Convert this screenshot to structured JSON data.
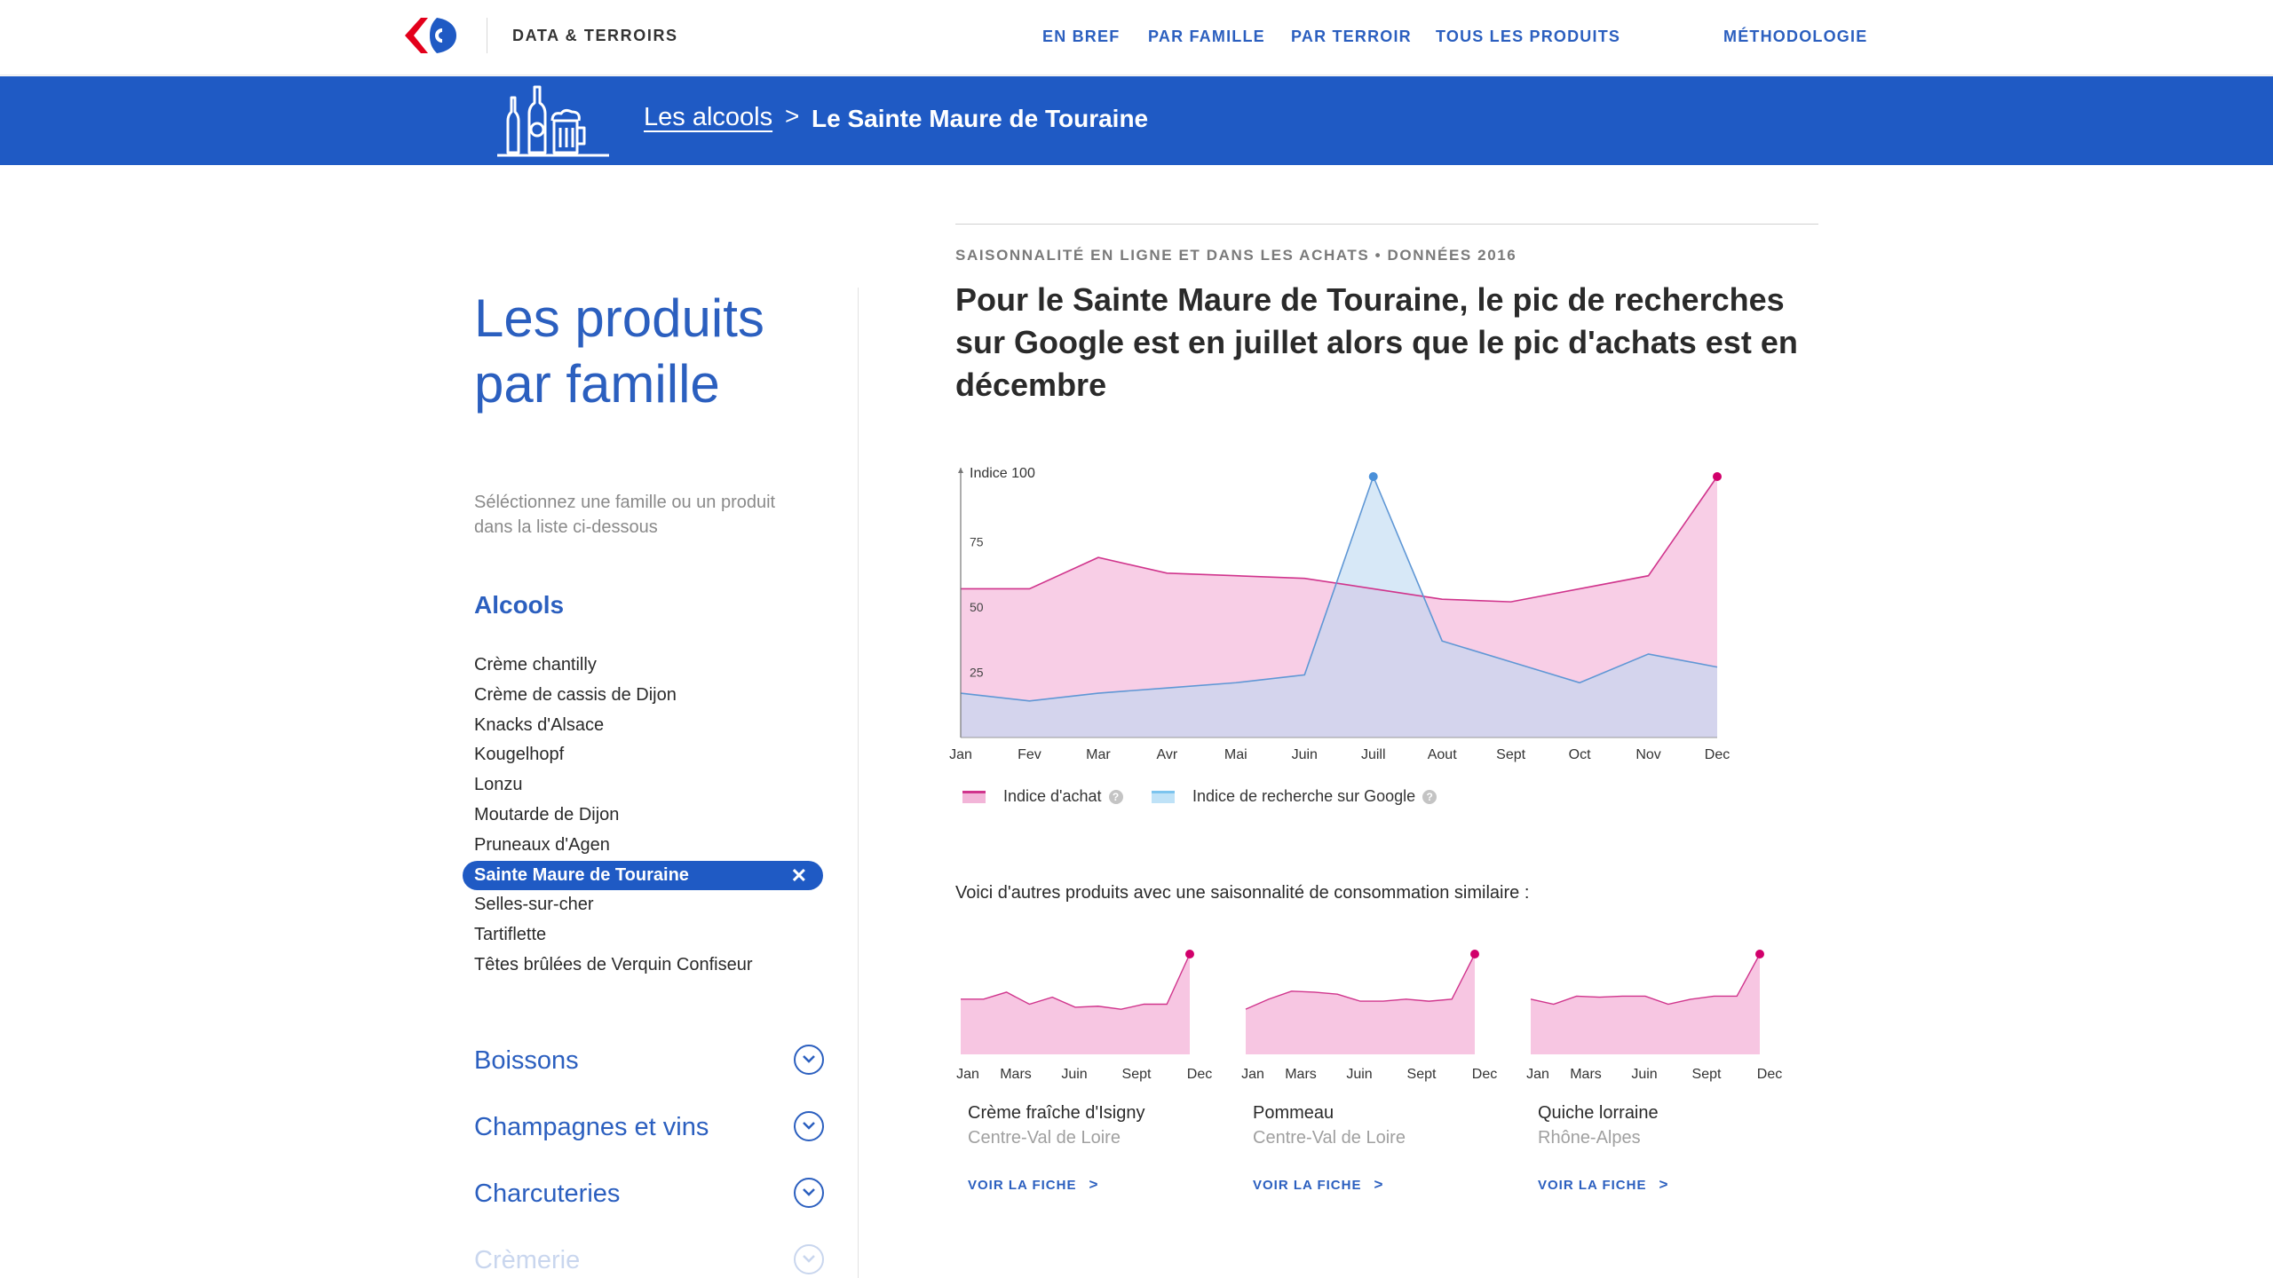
{
  "header": {
    "brand": "DATA & TERROIRS",
    "nav": [
      "EN BREF",
      "PAR FAMILLE",
      "PAR TERROIR",
      "TOUS LES PRODUITS",
      "MÉTHODOLOGIE"
    ]
  },
  "breadcrumb": {
    "parent": "Les alcools",
    "separator": ">",
    "current": "Le Sainte Maure de Touraine"
  },
  "sidebar": {
    "title_line1": "Les produits",
    "title_line2": "par famille",
    "hint": "Séléctionnez une famille ou un produit dans la liste ci-dessous",
    "family": "Alcools",
    "items": [
      "Crème chantilly",
      "Crème de cassis de Dijon",
      "Knacks d'Alsace",
      "Kougelhopf",
      "Lonzu",
      "Moutarde de Dijon",
      "Pruneaux d'Agen",
      "Sainte Maure de Touraine",
      "Selles-sur-cher",
      "Tartiflette",
      "Têtes brûlées de Verquin Confiseur"
    ],
    "selected_index": 7,
    "remove_glyph": "✕",
    "categories": [
      "Boissons",
      "Champagnes et vins",
      "Charcuteries",
      "Crèmerie"
    ]
  },
  "main": {
    "kicker": "SAISONNALITÉ EN LIGNE ET DANS LES ACHATS • DONNÉES 2016",
    "headline": "Pour le Sainte Maure de Touraine, le pic de recherches sur Google est en juillet alors que le pic d'achats est en décembre",
    "legend_purchase": "Indice d'achat",
    "legend_google": "Indice de recherche sur Google",
    "help_glyph": "?",
    "similar_intro": "Voici d'autres produits avec une saisonnalité de consommation similaire :",
    "similar_products": [
      {
        "name": "Crème fraîche d'Isigny",
        "region": "Centre-Val de Loire",
        "link": "VOIR LA FICHE",
        "arrow": ">"
      },
      {
        "name": "Pommeau",
        "region": "Centre-Val de Loire",
        "link": "VOIR LA FICHE",
        "arrow": ">"
      },
      {
        "name": "Quiche lorraine",
        "region": "Rhône-Alpes",
        "link": "VOIR LA FICHE",
        "arrow": ">"
      }
    ]
  },
  "colors": {
    "brand_blue": "#1f5ac4",
    "purchase_fill": "#f7c6e2",
    "purchase_line": "#d0348c",
    "purchase_peak": "#d1006b",
    "google_fill": "#bcd9f1",
    "google_line": "#5f97d5",
    "google_peak": "#4a90d9"
  },
  "chart_data": {
    "type": "area",
    "y_axis_label": "Indice 100",
    "y_ticks": [
      25,
      50,
      75
    ],
    "ylim": [
      0,
      100
    ],
    "categories": [
      "Jan",
      "Fev",
      "Mar",
      "Avr",
      "Mai",
      "Juin",
      "Juill",
      "Aout",
      "Sept",
      "Oct",
      "Nov",
      "Dec"
    ],
    "series": [
      {
        "name": "Indice d'achat",
        "values": [
          57,
          57,
          69,
          63,
          62,
          61,
          57,
          53,
          52,
          57,
          62,
          100
        ]
      },
      {
        "name": "Indice de recherche sur Google",
        "values": [
          17,
          14,
          17,
          19,
          21,
          24,
          100,
          37,
          29,
          21,
          32,
          27
        ]
      }
    ],
    "legend": "bottom-left",
    "grid": false
  },
  "mini_charts": {
    "tick_labels": [
      "Jan",
      "Mars",
      "Juin",
      "Sept",
      "Dec"
    ],
    "series": [
      [
        55,
        55,
        62,
        50,
        57,
        47,
        48,
        45,
        50,
        50,
        100
      ],
      [
        45,
        55,
        63,
        62,
        60,
        53,
        53,
        55,
        53,
        55,
        100
      ],
      [
        55,
        50,
        58,
        57,
        58,
        58,
        50,
        55,
        58,
        58,
        100
      ]
    ]
  }
}
